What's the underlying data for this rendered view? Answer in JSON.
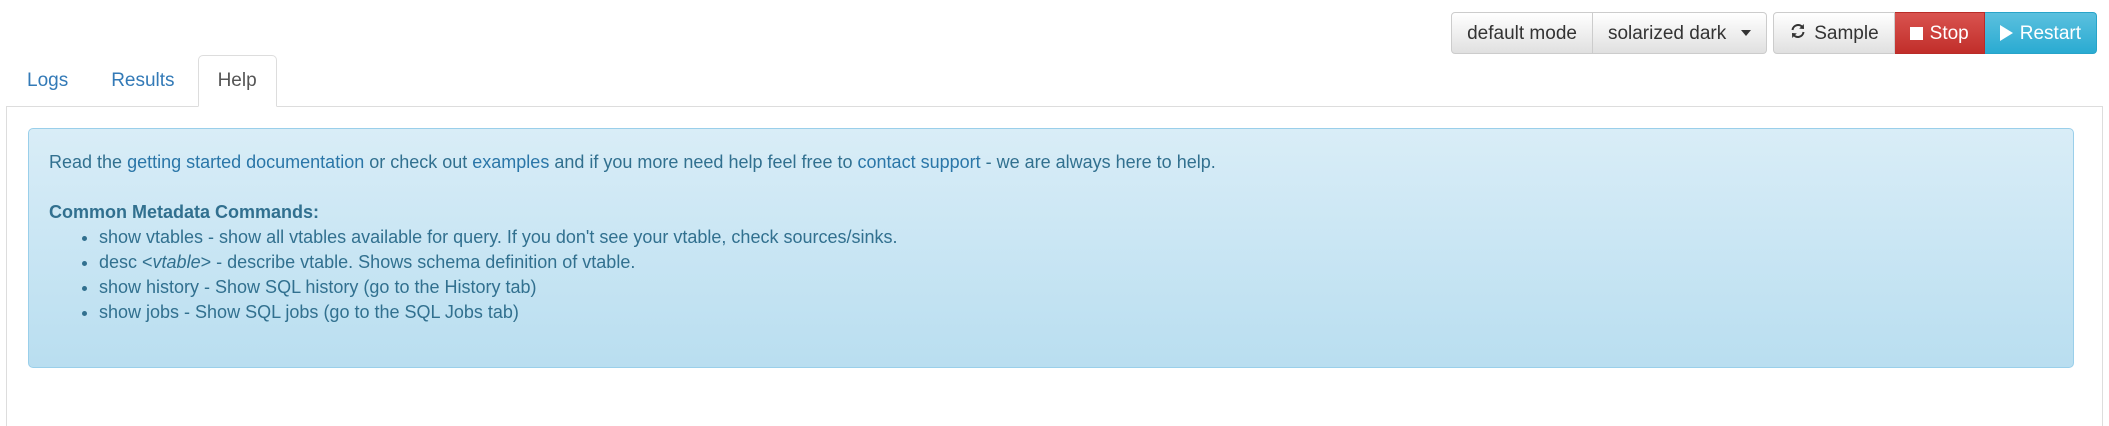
{
  "toolbar": {
    "mode_label": "default mode",
    "theme_label": "solarized dark",
    "sample_label": "Sample",
    "stop_label": "Stop",
    "restart_label": "Restart"
  },
  "tabs": [
    {
      "label": "Logs"
    },
    {
      "label": "Results"
    },
    {
      "label": "Help"
    }
  ],
  "help": {
    "intro": {
      "t1": "Read the ",
      "link1": "getting started documentation",
      "t2": " or check out ",
      "link2": "examples",
      "t3": " and if you more need help feel free to ",
      "link3": "contact support",
      "t4": " - we are always here to help."
    },
    "heading": "Common Metadata Commands:",
    "commands": [
      {
        "text": "show vtables - show all vtables available for query. If you don't see your vtable, check sources/sinks."
      },
      {
        "pre": "desc <",
        "em": "vtable",
        "post": "> - describe vtable. Shows schema definition of vtable."
      },
      {
        "text": "show history - Show SQL history (go to the History tab)"
      },
      {
        "text": "show jobs - Show SQL jobs (go to the SQL Jobs tab)"
      }
    ]
  },
  "colors": {
    "accent_link": "#337ab7",
    "alert_bg": "#d9edf7",
    "alert_text": "#31708f",
    "stop_button": "#d9534f",
    "restart_button": "#5bc0de"
  },
  "icons": {
    "caret": "caret-down-icon",
    "sample": "refresh-icon",
    "stop": "stop-icon",
    "restart": "play-icon"
  }
}
